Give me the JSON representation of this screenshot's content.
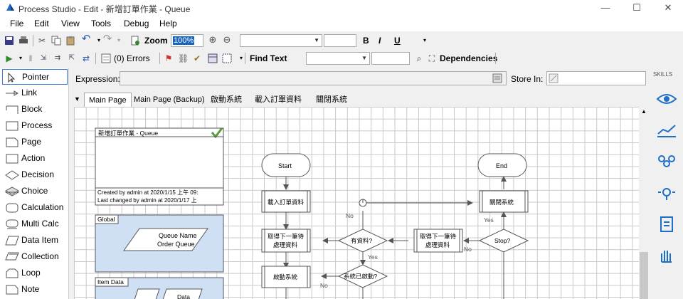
{
  "window": {
    "title": "Process Studio  - Edit - 新增訂單作業 - Queue",
    "minimize": "—",
    "maximize": "☐",
    "close": "✕"
  },
  "menu": [
    "File",
    "Edit",
    "View",
    "Tools",
    "Debug",
    "Help"
  ],
  "toolbar1": {
    "zoom_label": "Zoom",
    "zoom_value": "100%",
    "bold": "B",
    "italic": "I",
    "underline": "U"
  },
  "toolbar2": {
    "errors": "(0) Errors",
    "find_text": "Find Text",
    "dependencies": "Dependencies"
  },
  "tools": [
    "Pointer",
    "Link",
    "Block",
    "Process",
    "Page",
    "Action",
    "Decision",
    "Choice",
    "Calculation",
    "Multi Calc",
    "Data Item",
    "Collection",
    "Loop",
    "Note"
  ],
  "expression": {
    "label": "Expression:",
    "value": "",
    "store_in_label": "Store In:",
    "store_in_value": ""
  },
  "tabs": [
    "Main Page",
    "Main Page (Backup)",
    "啟動系統",
    "載入訂單資料",
    "關閉系統"
  ],
  "skills": {
    "label": "SKILLS",
    "icons": [
      "eye-icon",
      "graph-icon",
      "people-icon",
      "lightbulb-icon",
      "document-icon",
      "hand-icon"
    ]
  },
  "diagram": {
    "info_title": "新增訂單作業 - Queue",
    "created": "Created by admin at 2020/1/15 上午 09:",
    "changed": "Last changed by admin at 2020/1/17 上",
    "global_label": "Global",
    "queue_name": "Queue Name",
    "order_queue": "Order Queue",
    "item_data_label": "Item Data",
    "data_label": "Data",
    "start": "Start",
    "end": "End",
    "load_orders": "載入訂單資料",
    "close_system": "關閉系統",
    "get_next_1": "取得下一筆待",
    "get_next_2": "處理資料",
    "has_data": "有資料?",
    "stop": "Stop?",
    "launch_system": "啟動系統",
    "system_started": "系統已啟動?",
    "no": "No",
    "yes": "Yes"
  }
}
